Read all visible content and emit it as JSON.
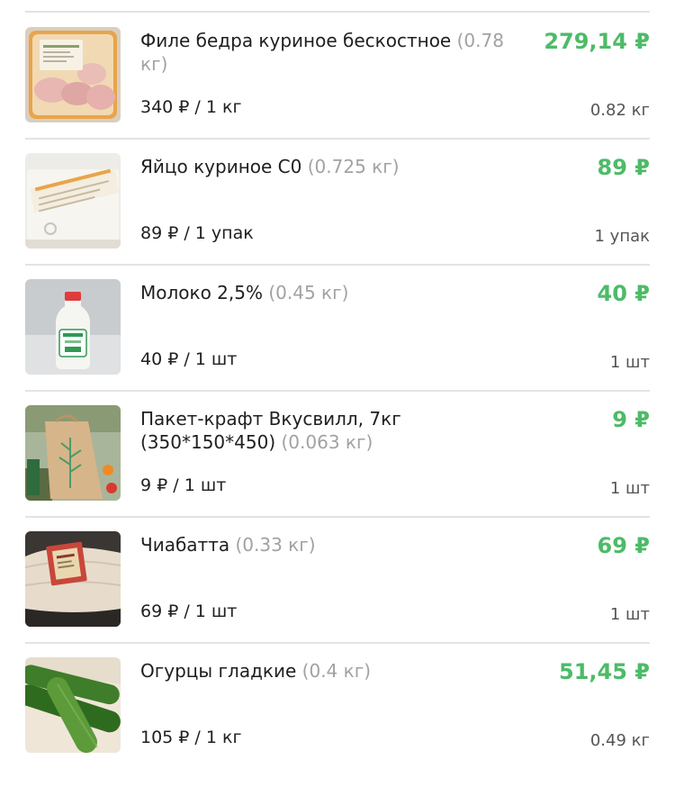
{
  "items": [
    {
      "name": "Филе бедра куриное бескостное",
      "weight": "(0.78 кг)",
      "price": "279,14 ₽",
      "unit_price": "340 ₽ / 1 кг",
      "quantity": "0.82 кг",
      "image": "chicken-thigh-tray"
    },
    {
      "name": "Яйцо куриное С0",
      "weight": "(0.725 кг)",
      "price": "89 ₽",
      "unit_price": "89 ₽ / 1 упак",
      "quantity": "1 упак",
      "image": "egg-carton"
    },
    {
      "name": "Молоко 2,5%",
      "weight": "(0.45 кг)",
      "price": "40 ₽",
      "unit_price": "40 ₽ / 1 шт",
      "quantity": "1 шт",
      "image": "milk-bottle"
    },
    {
      "name": "Пакет-крафт Вкусвилл, 7кг (350*150*450)",
      "weight": "(0.063 кг)",
      "price": "9 ₽",
      "unit_price": "9 ₽ / 1 шт",
      "quantity": "1 шт",
      "image": "kraft-bag"
    },
    {
      "name": "Чиабатта",
      "weight": "(0.33 кг)",
      "price": "69 ₽",
      "unit_price": "69 ₽ / 1 шт",
      "quantity": "1 шт",
      "image": "ciabatta-bread"
    },
    {
      "name": "Огурцы гладкие",
      "weight": "(0.4 кг)",
      "price": "51,45 ₽",
      "unit_price": "105 ₽ / 1 кг",
      "quantity": "0.49 кг",
      "image": "cucumbers"
    }
  ],
  "colors": {
    "price_green": "#4dbb68",
    "weight_gray": "#a2a2a2",
    "divider": "#e3e3e3"
  }
}
